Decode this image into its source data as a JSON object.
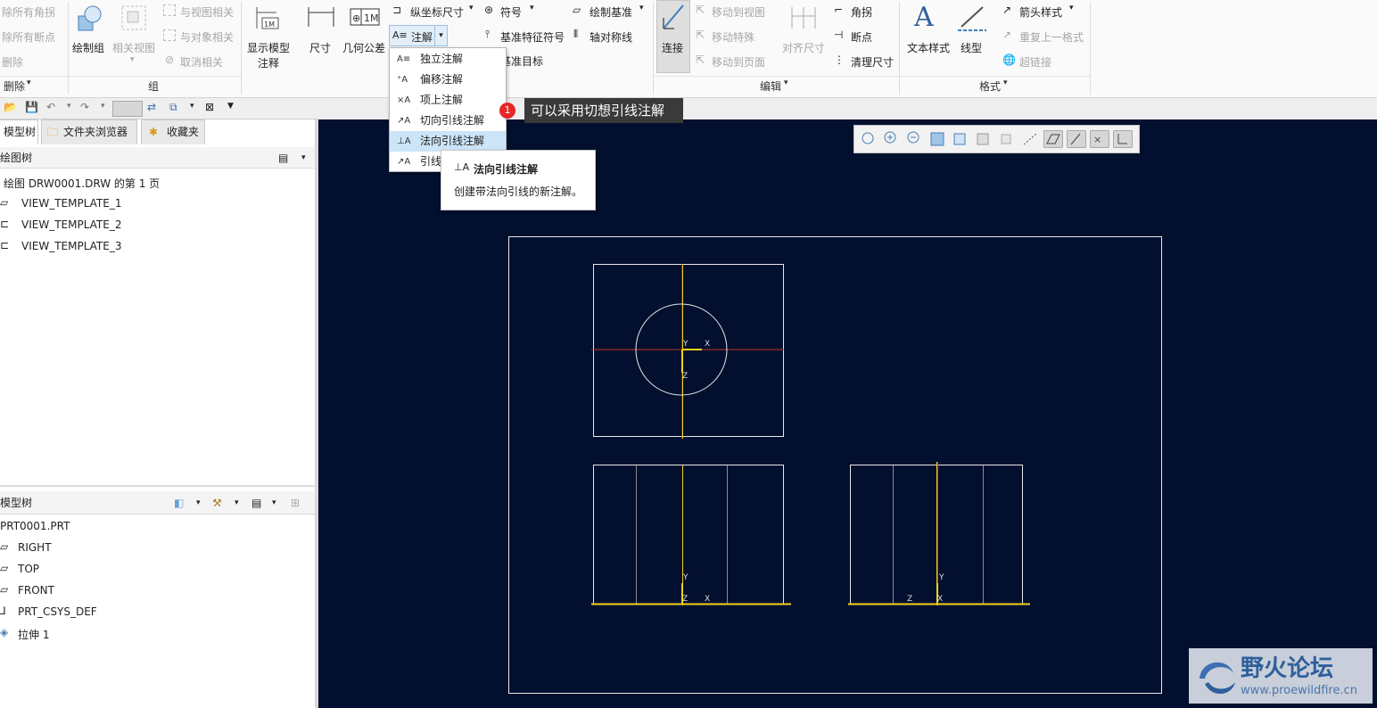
{
  "ribbon": {
    "col1": [
      "除所有角拐",
      "除所有断点",
      "删除"
    ],
    "draw_group": "绘制组",
    "related_view": "相关视图",
    "col3": [
      "与视图相关",
      "与对象相关",
      "取消相关"
    ],
    "show_model_annotations": [
      "显示模型",
      "注释"
    ],
    "dimension": "尺寸",
    "geom_tolerance": "几何公差",
    "ordinate_dim": "纵坐标尺寸",
    "note": "注解",
    "symbol": "符号",
    "datum_feature_symbol": "基准特征符号",
    "datum_target": "基准目标",
    "draw_datum": "绘制基准",
    "axis_symmetry": "轴对称线",
    "connect": "连接",
    "edit_col": [
      "移动到视图",
      "移动特殊",
      "移动到页面"
    ],
    "align_dim": "对齐尺寸",
    "edit_col2": [
      "角拐",
      "断点",
      "清理尺寸"
    ],
    "text_style": "文本样式",
    "line_style": "线型",
    "format_col": [
      "箭头样式",
      "重复上一格式",
      "超链接"
    ],
    "groups": {
      "delete": "删除",
      "group": "组",
      "edit": "编辑",
      "format": "格式"
    }
  },
  "dropdown": {
    "items": [
      "独立注解",
      "偏移注解",
      "项上注解",
      "切向引线注解",
      "法向引线注解",
      "引线"
    ]
  },
  "tooltip": {
    "title": "法向引线注解",
    "body": "创建带法向引线的新注解。"
  },
  "callout": {
    "badge": "1",
    "text": "可以采用切想引线注解"
  },
  "leftpanel": {
    "tabs": [
      "模型树",
      "文件夹浏览器",
      "收藏夹"
    ],
    "drawing_tree_title": "绘图树",
    "drawing_items": [
      "绘图 DRW0001.DRW 的第 1 页",
      "VIEW_TEMPLATE_1",
      "VIEW_TEMPLATE_2",
      "VIEW_TEMPLATE_3"
    ],
    "model_tree_title": "模型树",
    "model_items": [
      "PRT0001.PRT",
      "RIGHT",
      "TOP",
      "FRONT",
      "PRT_CSYS_DEF",
      "拉伸 1"
    ]
  },
  "canvas": {
    "axis_labels": {
      "y": "Y",
      "x": "X",
      "z": "Z"
    }
  },
  "watermark": {
    "title": "野火论坛",
    "url": "www.proewildfire.cn"
  },
  "colors": {
    "canvas_bg": "#020f2e",
    "highlight": "#cce4f7",
    "axis_yellow": "#f2d21a",
    "axis_red": "#c0392b"
  }
}
